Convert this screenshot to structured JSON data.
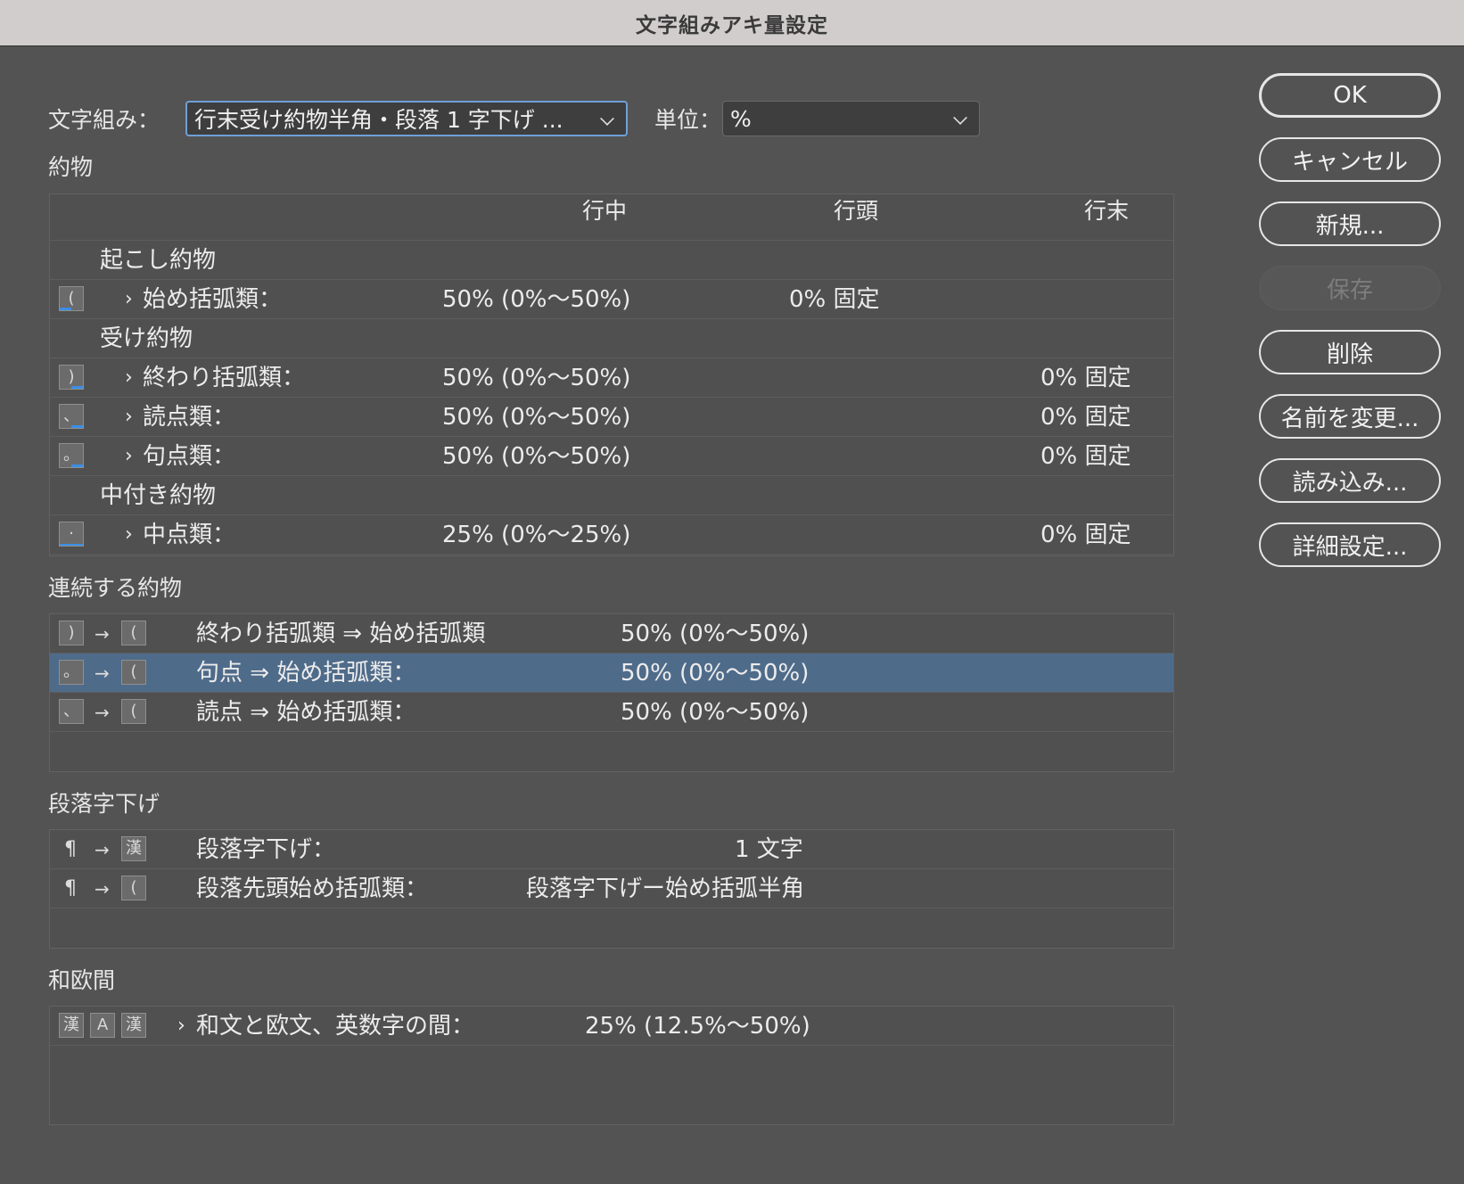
{
  "window": {
    "title": "文字組みアキ量設定"
  },
  "toolbar": {
    "mojikumi_label": "文字組み：",
    "mojikumi_value": "行末受け約物半角・段落 1 字下げ ...",
    "unit_label": "単位：",
    "unit_value": "%"
  },
  "yakumono": {
    "section_title": "約物",
    "headers": {
      "mid": "行中",
      "start": "行頭",
      "end": "行末"
    },
    "groups": {
      "okoshi": "起こし約物",
      "uke": "受け約物",
      "nakatsuki": "中付き約物"
    },
    "rows": {
      "hajime_kakko": {
        "label": "始め括弧類：",
        "mid": "50% (0%〜50%)",
        "start": "0% 固定",
        "end": ""
      },
      "owari_kakko": {
        "label": "終わり括弧類：",
        "mid": "50% (0%〜50%)",
        "start": "",
        "end": "0% 固定"
      },
      "tooten": {
        "label": "読点類：",
        "mid": "50% (0%〜50%)",
        "start": "",
        "end": "0% 固定"
      },
      "kuten": {
        "label": "句点類：",
        "mid": "50% (0%〜50%)",
        "start": "",
        "end": "0% 固定"
      },
      "nakaguro": {
        "label": "中点類：",
        "mid": "25% (0%〜25%)",
        "start": "",
        "end": "0% 固定"
      }
    }
  },
  "renzoku": {
    "section_title": "連続する約物",
    "rows": [
      {
        "label": "終わり括弧類 ⇒ 始め括弧類",
        "value": "50% (0%〜50%)"
      },
      {
        "label": "句点 ⇒ 始め括弧類：",
        "value": "50% (0%〜50%)"
      },
      {
        "label": "読点 ⇒ 始め括弧類：",
        "value": "50% (0%〜50%)"
      }
    ]
  },
  "jisage": {
    "section_title": "段落字下げ",
    "rows": [
      {
        "label": "段落字下げ：",
        "value": "1 文字"
      },
      {
        "label": "段落先頭始め括弧類：",
        "value": "段落字下げー始め括弧半角"
      }
    ]
  },
  "waou": {
    "section_title": "和欧間",
    "rows": [
      {
        "label": "和文と欧文、英数字の間：",
        "value": "25% (12.5%〜50%)"
      }
    ]
  },
  "buttons": {
    "ok": "OK",
    "cancel": "キャンセル",
    "new": "新規...",
    "save": "保存",
    "delete": "削除",
    "rename": "名前を変更...",
    "load": "読み込み...",
    "advanced": "詳細設定..."
  },
  "icons": {
    "kanji_glyph": "漢",
    "alpha_glyph": "A",
    "pilcrow": "¶",
    "arrow": "→",
    "chevron": "›"
  },
  "colors": {
    "selected_row": "#4f6b8a",
    "icon_accent": "#3a8ee6"
  }
}
